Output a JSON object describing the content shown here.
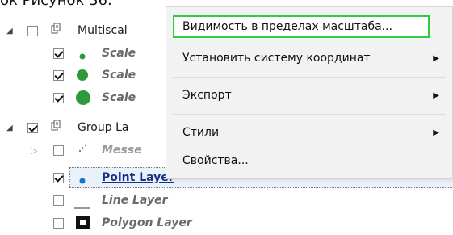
{
  "caption": "ок Рисунок 36.",
  "tree": {
    "multiscale": {
      "label": "Multiscal"
    },
    "scale1": {
      "label": "Scale"
    },
    "scale2": {
      "label": "Scale"
    },
    "scale3": {
      "label": "Scale"
    },
    "group": {
      "label": "Group La"
    },
    "messages": {
      "label": "Messe"
    },
    "point_layer": {
      "label": "Point Layer"
    },
    "line_layer": {
      "label": "Line Layer"
    },
    "polygon_layer": {
      "label": "Polygon Layer"
    }
  },
  "menu": {
    "items": [
      {
        "label": "Видимость в пределах масштаба...",
        "submenu": false
      },
      {
        "label": "Установить систему координат",
        "submenu": true
      },
      {
        "label": "Экспорт",
        "submenu": true
      },
      {
        "label": "Стили",
        "submenu": true
      },
      {
        "label": "Свойства...",
        "submenu": false
      }
    ]
  },
  "colors": {
    "highlight_border": "#2ecc40",
    "point_blue": "#1f6fd1",
    "scale_green": "#2e9a3c"
  }
}
